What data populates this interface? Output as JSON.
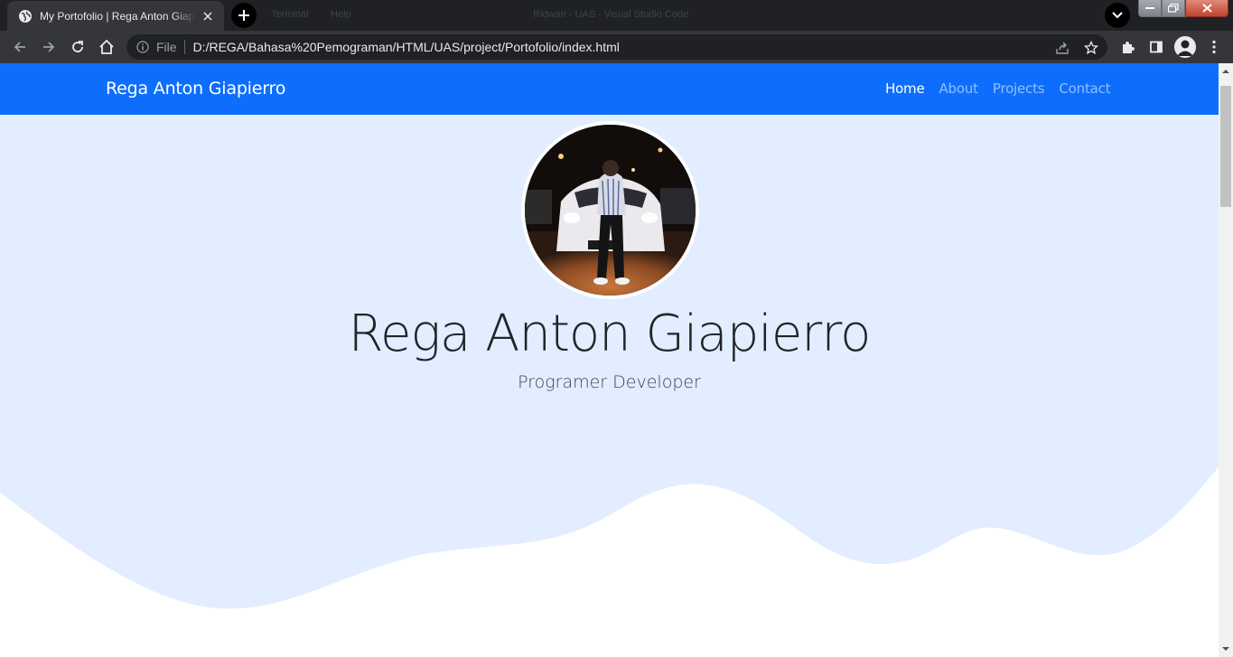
{
  "browser": {
    "tab": {
      "title": "My Portofolio | Rega Anton Giapierro",
      "favicon": "globe-icon"
    },
    "address": {
      "scheme": "File",
      "url": "D:/REGA/Bahasa%20Pemograman/HTML/UAS/project/Portofolio/index.html"
    },
    "background_window_text": [
      "Terminal",
      "Help",
      "Ridwan - UAS - Visual Studio Code"
    ]
  },
  "navbar": {
    "brand": "Rega Anton Giapierro",
    "links": [
      {
        "label": "Home",
        "active": true
      },
      {
        "label": "About",
        "active": false
      },
      {
        "label": "Projects",
        "active": false
      },
      {
        "label": "Contact",
        "active": false
      }
    ],
    "background_color": "#0d6efd"
  },
  "hero": {
    "name": "Rega Anton Giapierro",
    "subtitle": "Programer Developer",
    "photo": "profile-photo",
    "background_color": "#e2edff"
  }
}
